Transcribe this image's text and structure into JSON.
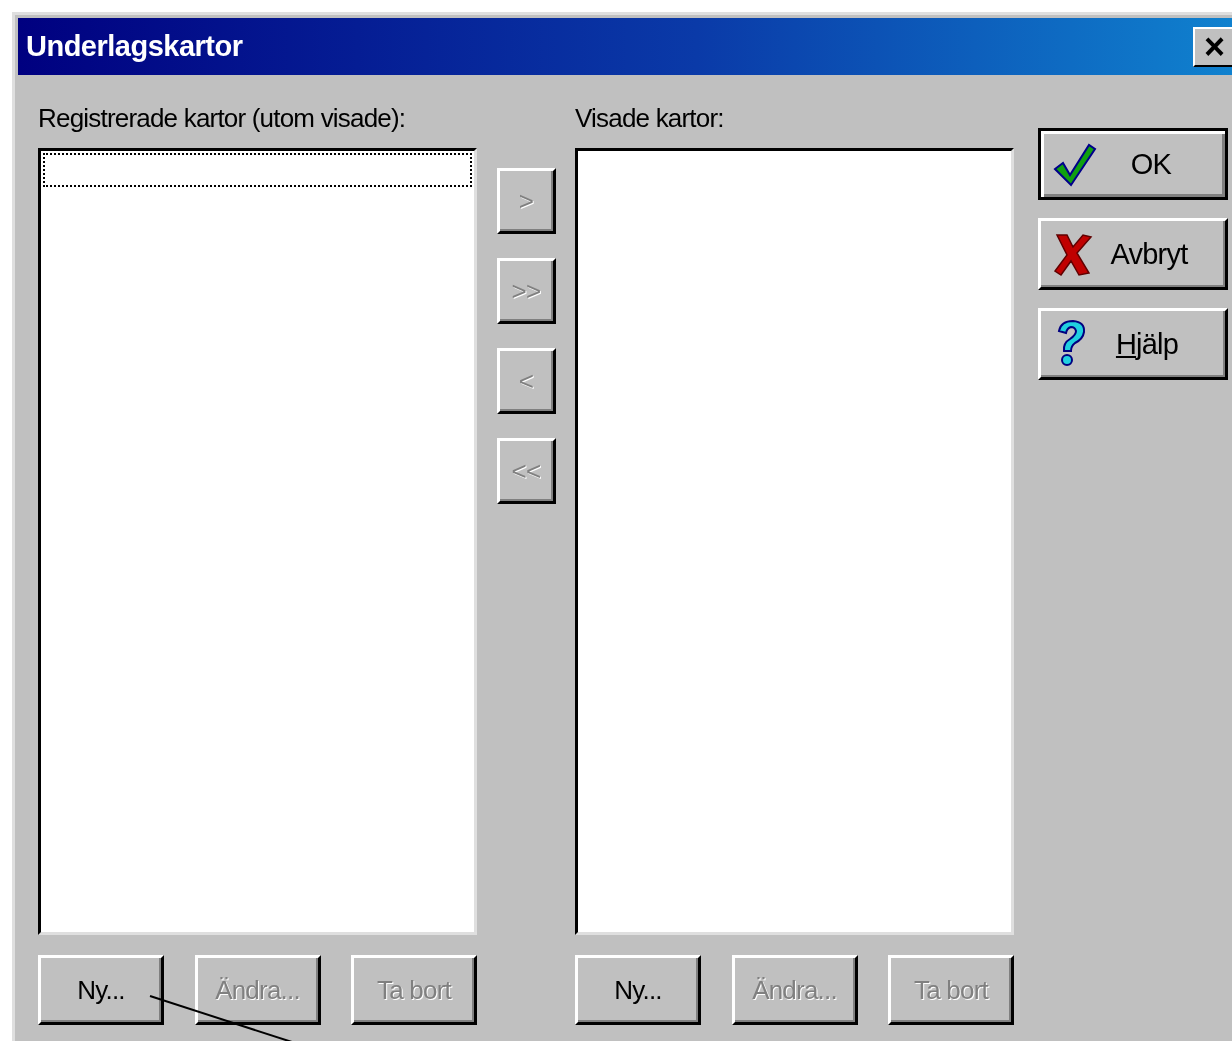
{
  "window": {
    "title": "Underlagskartor",
    "close_label": "×"
  },
  "lists": [
    {
      "label": "Registrerade kartor (utom visade):",
      "focused": true,
      "buttons": [
        {
          "label": "Ny...",
          "disabled": false
        },
        {
          "label": "Ändra...",
          "disabled": true
        },
        {
          "label": "Ta bort",
          "disabled": true
        }
      ]
    },
    {
      "label": "Visade kartor:",
      "focused": false,
      "buttons": [
        {
          "label": "Ny...",
          "disabled": false
        },
        {
          "label": "Ändra...",
          "disabled": true
        },
        {
          "label": "Ta bort",
          "disabled": true
        }
      ]
    }
  ],
  "move_buttons": [
    {
      "label": ">",
      "disabled": true
    },
    {
      "label": ">>",
      "disabled": true
    },
    {
      "label": "<",
      "disabled": true
    },
    {
      "label": "<<",
      "disabled": true
    }
  ],
  "action_buttons": [
    {
      "label": "OK",
      "kind": "ok",
      "default": true,
      "underline_first": false
    },
    {
      "label": "Avbryt",
      "kind": "cancel",
      "default": false,
      "underline_first": false
    },
    {
      "label": "Hjälp",
      "kind": "help",
      "default": false,
      "underline_first": true
    }
  ]
}
